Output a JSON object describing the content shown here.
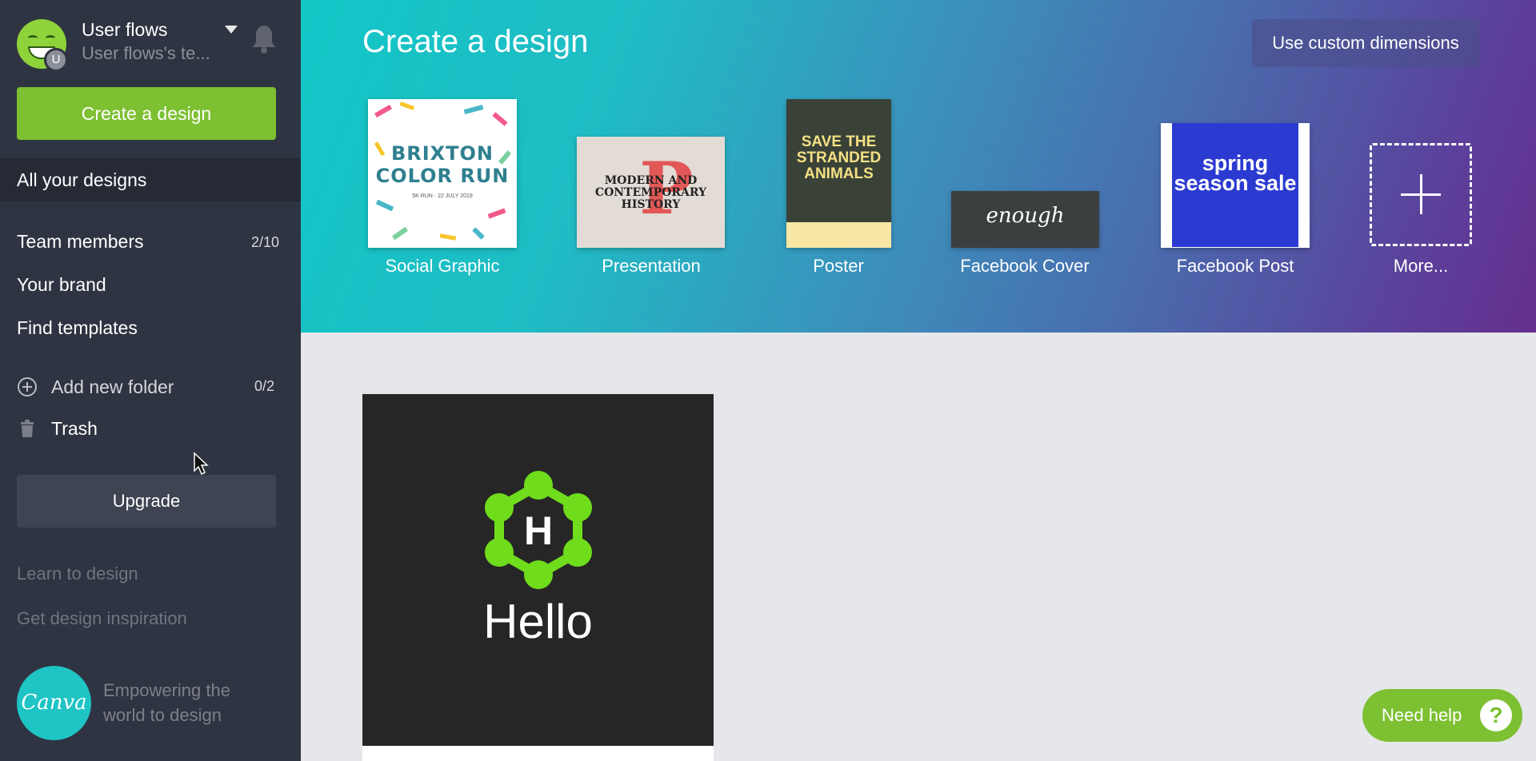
{
  "account": {
    "name": "User flows",
    "team": "User flows's te...",
    "avatar_badge": "U"
  },
  "sidebar": {
    "create_button": "Create a design",
    "active_item": "All your designs",
    "items": [
      {
        "label": "Team members",
        "count": "2/10"
      },
      {
        "label": "Your brand"
      },
      {
        "label": "Find templates"
      }
    ],
    "add_folder": {
      "label": "Add new folder",
      "count": "0/2"
    },
    "trash": "Trash",
    "upgrade_button": "Upgrade",
    "links": [
      "Learn to design",
      "Get design inspiration"
    ],
    "logo_text": "Canva",
    "tagline": "Empowering the world to design"
  },
  "banner": {
    "title": "Create a design",
    "custom_dimensions_button": "Use custom dimensions",
    "design_types": [
      {
        "label": "Social Graphic",
        "thumb_title": "BRIXTON COLOR RUN",
        "thumb_sub": "5K RUN · 22 JULY 2019"
      },
      {
        "label": "Presentation",
        "thumb_title": "MODERN AND CONTEMPORARY HISTORY",
        "thumb_letter": "P"
      },
      {
        "label": "Poster",
        "thumb_title": "SAVE THE STRANDED ANIMALS"
      },
      {
        "label": "Facebook Cover",
        "thumb_title": "enough"
      },
      {
        "label": "Facebook Post",
        "thumb_title": "spring season sale"
      },
      {
        "label": "More..."
      }
    ]
  },
  "design_card": {
    "logo_letter": "H",
    "text": "Hello"
  },
  "help_button": {
    "label": "Need help",
    "icon": "?"
  },
  "colors": {
    "sidebar_bg": "#2f3442",
    "accent_green": "#7dc032",
    "banner_start": "#12c6c6",
    "banner_end": "#652f8f",
    "canva_teal": "#1fc4c4"
  }
}
